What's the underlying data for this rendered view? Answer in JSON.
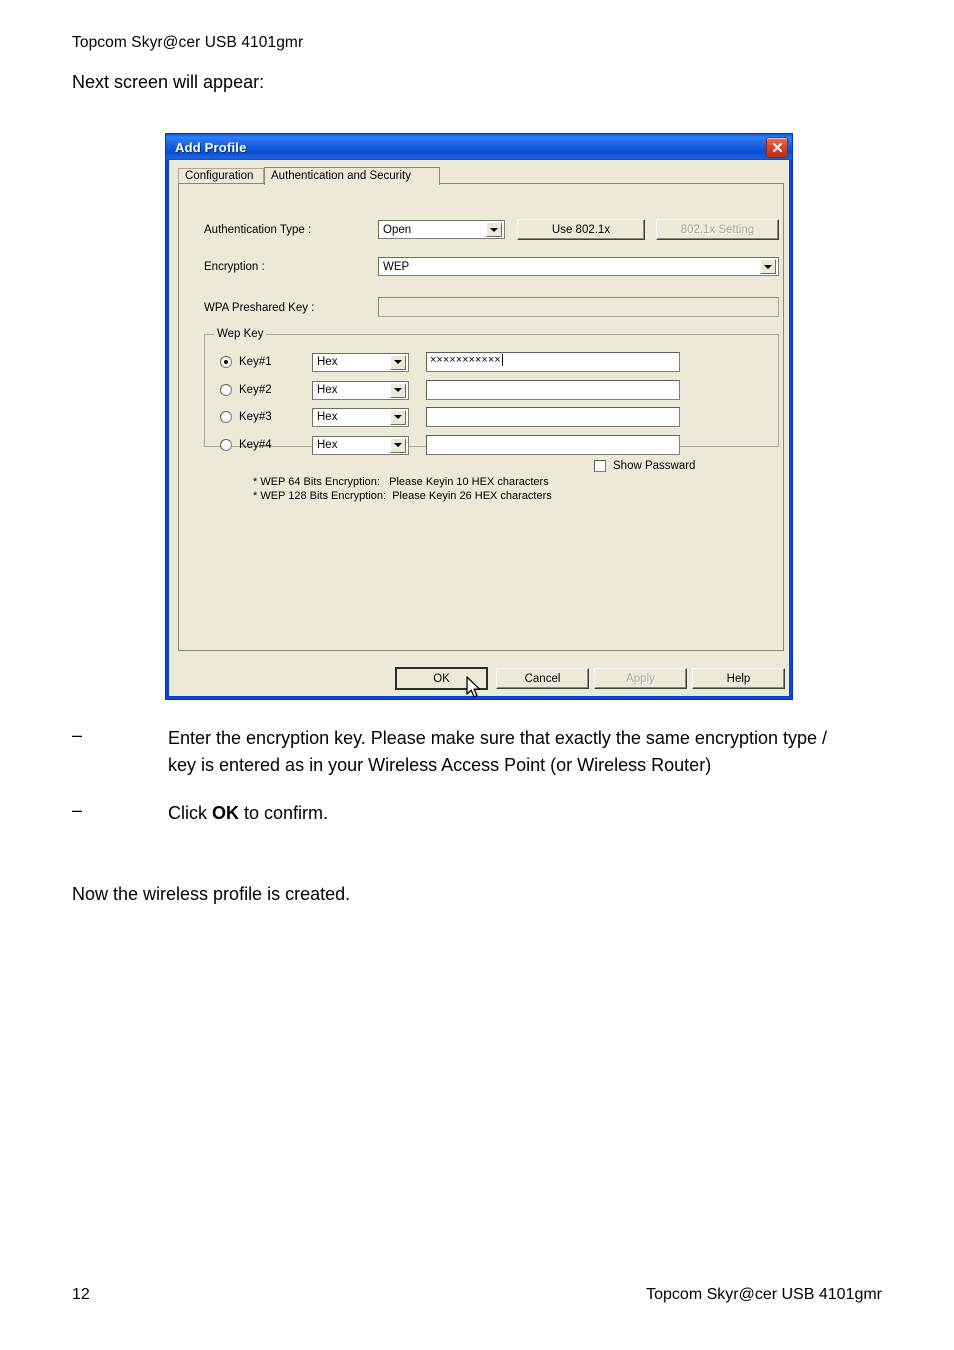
{
  "document": {
    "header": "Topcom Skyr@cer USB 4101gmr",
    "intro": "Next screen will appear:",
    "bullets": [
      {
        "marker": "–",
        "text": "Enter the encryption key. Please make sure that exactly the same encryption type / key is entered as in your Wireless Access Point (or Wireless Router)"
      },
      {
        "marker": "–",
        "text_before": "Click ",
        "text_bold": "OK",
        "text_after": " to confirm."
      }
    ],
    "closing": "Now the wireless profile is created.",
    "footer_page": "12",
    "footer_title": "Topcom Skyr@cer USB 4101gmr"
  },
  "dialog": {
    "title": "Add Profile",
    "close_icon": "close-icon",
    "tabs": [
      {
        "label": "Configuration",
        "active": false
      },
      {
        "label": "Authentication and Security",
        "active": true
      }
    ],
    "fields": {
      "auth_type_label": "Authentication Type :",
      "auth_type_value": "Open",
      "use_8021x_label": "Use 802.1x",
      "setting_8021x_label": "802.1x Setting",
      "encryption_label": "Encryption :",
      "encryption_value": "WEP",
      "wpa_key_label": "WPA Preshared Key :",
      "wpa_key_value": ""
    },
    "wep_group": {
      "title": "Wep Key",
      "keys": [
        {
          "label": "Key#1",
          "selected": true,
          "format": "Hex",
          "value": "×××××××××××"
        },
        {
          "label": "Key#2",
          "selected": false,
          "format": "Hex",
          "value": ""
        },
        {
          "label": "Key#3",
          "selected": false,
          "format": "Hex",
          "value": ""
        },
        {
          "label": "Key#4",
          "selected": false,
          "format": "Hex",
          "value": ""
        }
      ],
      "note_line1": "* WEP 64 Bits Encryption:   Please Keyin 10 HEX characters",
      "note_line2": "* WEP 128 Bits Encryption:  Please Keyin 26 HEX characters"
    },
    "show_password": {
      "label": "Show Passward",
      "checked": false
    },
    "buttons": [
      {
        "label": "OK",
        "disabled": false,
        "focused": true
      },
      {
        "label": "Cancel",
        "disabled": false,
        "focused": false
      },
      {
        "label": "Apply",
        "disabled": true,
        "focused": false
      },
      {
        "label": "Help",
        "disabled": false,
        "focused": false
      }
    ]
  },
  "colors": {
    "dialog_face": "#ece9d8",
    "title_blue": "#0a46d4",
    "close_red": "#d9452a",
    "field_white": "#ffffff",
    "disabled_text": "#a9a596"
  }
}
